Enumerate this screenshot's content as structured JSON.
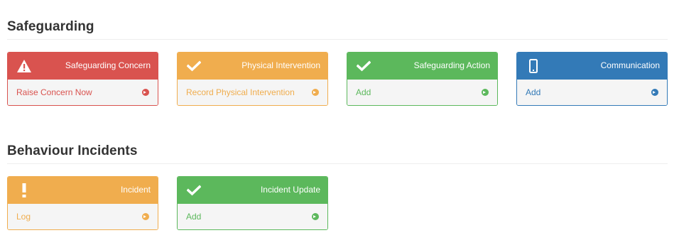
{
  "sections": [
    {
      "title": "Safeguarding",
      "cards": [
        {
          "title": "Safeguarding Concern",
          "link": "Raise Concern Now",
          "color": "#d9534f",
          "icon": "warning-icon"
        },
        {
          "title": "Physical Intervention",
          "link": "Record Physical Intervention",
          "color": "#f0ad4e",
          "icon": "check-icon"
        },
        {
          "title": "Safeguarding Action",
          "link": "Add",
          "color": "#5cb85c",
          "icon": "check-icon"
        },
        {
          "title": "Communication",
          "link": "Add",
          "color": "#337ab7",
          "icon": "mobile-phone-icon"
        }
      ]
    },
    {
      "title": "Behaviour Incidents",
      "cards": [
        {
          "title": "Incident",
          "link": "Log",
          "color": "#f0ad4e",
          "icon": "exclamation-icon"
        },
        {
          "title": "Incident Update",
          "link": "Add",
          "color": "#5cb85c",
          "icon": "check-icon"
        }
      ]
    }
  ]
}
